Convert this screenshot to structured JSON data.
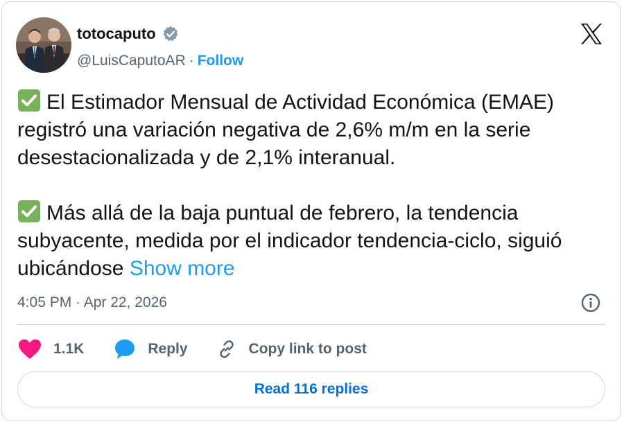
{
  "author": {
    "display_name": "totocaputo",
    "handle": "@LuisCaputoAR",
    "separator": "·",
    "follow_label": "Follow",
    "verified": true
  },
  "icons": {
    "verified": "verified-badge-icon",
    "logo": "x-logo-icon",
    "check": "check-mark-icon",
    "info": "info-icon",
    "like": "heart-icon",
    "reply": "speech-bubble-icon",
    "copy": "link-icon"
  },
  "tweet": {
    "paragraph_1": "El Estimador Mensual de Actividad Económica (EMAE) registró una variación negativa de 2,6% m/m en la serie desestacionalizada y de 2,1% interanual.",
    "paragraph_2": "Más allá de la baja puntual de febrero, la tendencia subyacente, medida por el indicador tendencia-ciclo, siguió ubicándose",
    "show_more_label": "Show more",
    "timestamp": "4:05 PM · Apr 22, 2026"
  },
  "actions": {
    "like_count": "1.1K",
    "reply_label": "Reply",
    "copy_label": "Copy link to post"
  },
  "read_replies_label": "Read 116 replies",
  "colors": {
    "accent": "#1d9bf0",
    "link_dark": "#006fd6",
    "text": "#0f1419",
    "muted": "#536471",
    "border": "#cfd9de",
    "like": "#f91880",
    "check_bg": "#78b159"
  }
}
